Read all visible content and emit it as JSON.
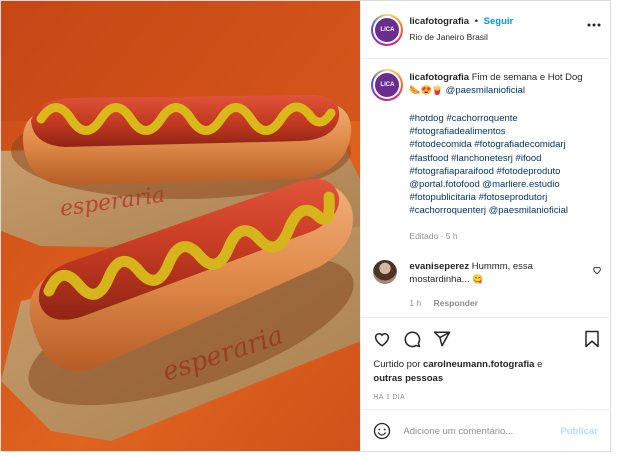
{
  "post": {
    "username": "licafotografia",
    "separator": "•",
    "follow_label": "Seguir",
    "location": "Rio de Janeiro Brasil",
    "avatar_text": "LICA"
  },
  "caption": {
    "username": "licafotografia",
    "text": "Fim de semana e Hot Dog",
    "emojis": "🌭😍🍟",
    "mention": "@paesmilanioficial",
    "hashtags": [
      "#hotdog #cachorroquente",
      "#fotografiadealimentos",
      "#fotodecomida #fotografiadecomidarj",
      "#fastfood #lanchonetesrj #ifood",
      "#fotografiaparaifood #fotodeproduto",
      "@portal.fotofood @marliere.estudio",
      "#fotopublicitaria #fotoseprodutorj",
      "#cachorroquenterj @paesmilanioficial"
    ],
    "meta": "Editado · 5 h"
  },
  "comment": {
    "username": "evaniseperez",
    "text_line1": "Hummm, essa",
    "text_line2": "mostardinha...",
    "emoji": "😋",
    "time": "1 h",
    "reply_label": "Responder"
  },
  "likes": {
    "prefix": "Curtido por",
    "user": "carolneumann.fotografia",
    "suffix": "e",
    "others": "outras pessoas"
  },
  "timestamp": "HÁ 1 DIA",
  "add_comment": {
    "placeholder": "Adicione um comentário...",
    "publish_label": "Publicar"
  },
  "photo": {
    "printed_text": "esperaria"
  },
  "colors": {
    "background_orange": "#d8581f",
    "link_blue": "#00376b",
    "follow_blue": "#0095f6",
    "publish_disabled": "#b2dffc",
    "muted": "#8e8e8e"
  },
  "icons": [
    "heart-icon",
    "comment-icon",
    "share-icon",
    "bookmark-icon",
    "emoji-icon",
    "small-heart-icon"
  ]
}
